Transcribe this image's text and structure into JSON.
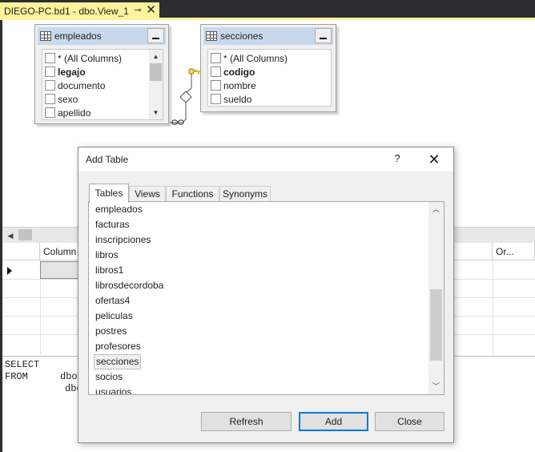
{
  "document_tab": {
    "title": "DIEGO-PC.bd1 - dbo.View_1",
    "pin_glyph": "⊸",
    "close_glyph": "✕"
  },
  "diagram": {
    "tables": [
      {
        "name": "empleados",
        "columns": [
          {
            "label": "* (All Columns)",
            "bold": false
          },
          {
            "label": "legajo",
            "bold": true
          },
          {
            "label": "documento",
            "bold": false
          },
          {
            "label": "sexo",
            "bold": false
          },
          {
            "label": "apellido",
            "bold": false
          }
        ]
      },
      {
        "name": "secciones",
        "columns": [
          {
            "label": "* (All Columns)",
            "bold": false
          },
          {
            "label": "codigo",
            "bold": true
          },
          {
            "label": "nombre",
            "bold": false
          },
          {
            "label": "sueldo",
            "bold": false
          }
        ]
      }
    ]
  },
  "grid": {
    "headers": {
      "column": "Column",
      "or": "Or..."
    }
  },
  "sql": {
    "line1": "SELECT",
    "line2_keyword": "FROM",
    "line2_rest": "dbo.",
    "line3": "dbo"
  },
  "dialog": {
    "title": "Add Table",
    "help_label": "?",
    "close_label": "✕",
    "tabs": [
      "Tables",
      "Views",
      "Functions",
      "Synonyms"
    ],
    "active_tab": "Tables",
    "items": [
      "empleados",
      "facturas",
      "inscripciones",
      "libros",
      "libros1",
      "librosdecordoba",
      "ofertas4",
      "peliculas",
      "postres",
      "profesores",
      "secciones",
      "socios",
      "usuarios"
    ],
    "selected_item": "secciones",
    "buttons": {
      "refresh": "Refresh",
      "add": "Add",
      "close": "Close"
    }
  },
  "colors": {
    "tab_accent": "#fff29d",
    "chrome_dark": "#2d2d30",
    "table_header": "#c9d9ed",
    "default_button_border": "#0078d7"
  },
  "icons": {
    "table_header": "table-grid-icon",
    "relationship_key": "key-icon",
    "relationship_infinity": "infinity-icon"
  }
}
